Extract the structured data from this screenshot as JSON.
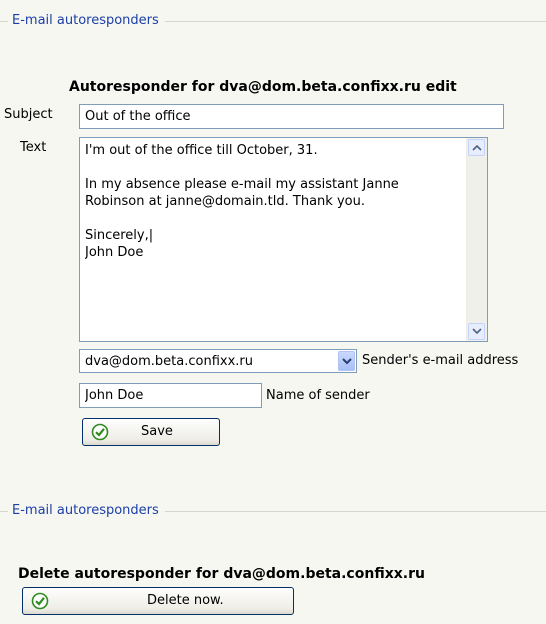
{
  "section1": {
    "legend": "E-mail autoresponders",
    "heading": "Autoresponder for dva@dom.beta.confixx.ru edit",
    "subject_label": "Subject",
    "subject_value": "Out of the office",
    "text_label": "Text",
    "text_value": "I'm out of the office till October, 31.\n\nIn my absence please e-mail my assistant Janne\nRobinson at janne@domain.tld. Thank you.\n\nSincerely,|\nJohn Doe",
    "sender_select_value": "dva@dom.beta.confixx.ru",
    "sender_select_label": "Sender's e-mail address",
    "sender_name_value": "John Doe",
    "sender_name_label": "Name of sender",
    "save_label": "Save"
  },
  "section2": {
    "legend": "E-mail autoresponders",
    "heading": "Delete autoresponder for dva@dom.beta.confixx.ru",
    "delete_label": "Delete now."
  },
  "colors": {
    "legend": "#1b3ea8",
    "input_border": "#7f9db9",
    "check_icon": "#2f8a1f"
  },
  "icons": {
    "save_icon": "check-circle-icon",
    "delete_icon": "check-circle-icon",
    "dropdown": "chevron-down-icon",
    "scroll_up": "chevron-up-icon",
    "scroll_down": "chevron-down-icon"
  }
}
